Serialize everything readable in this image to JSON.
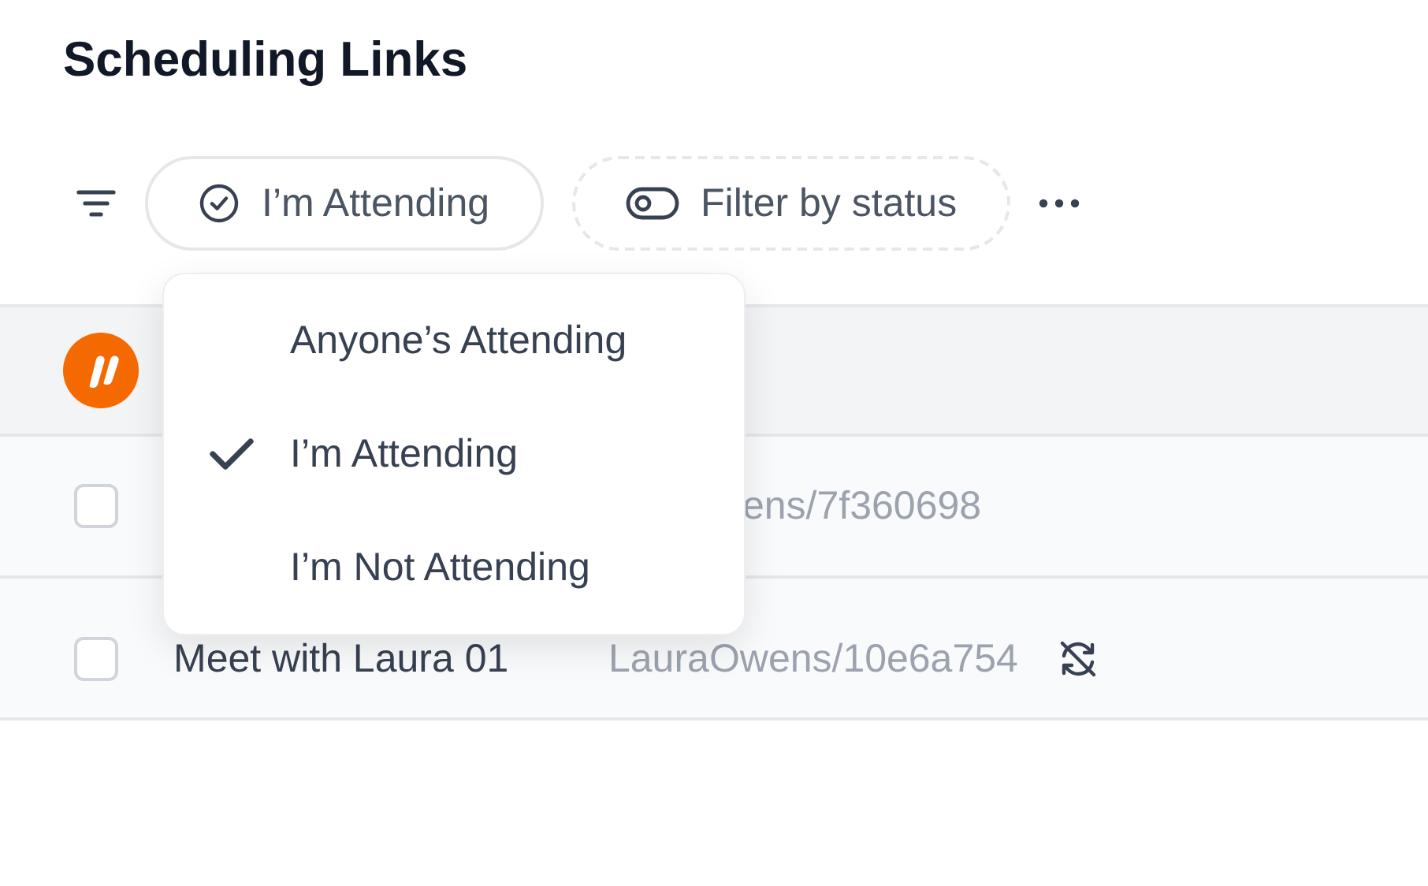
{
  "title": "Scheduling Links",
  "toolbar": {
    "filters": [
      {
        "kind": "attending",
        "label": "I’m Attending"
      },
      {
        "kind": "status",
        "label": "Filter by status"
      }
    ]
  },
  "menu": {
    "items": [
      {
        "label": "Anyone’s Attending",
        "selected": false
      },
      {
        "label": "I’m Attending",
        "selected": true
      },
      {
        "label": "I’m Not Attending",
        "selected": false
      }
    ]
  },
  "rows": [
    {
      "link": "ens/7f360698",
      "checked": false,
      "sync_off": false
    },
    {
      "name": "Meet with Laura 01",
      "link": "LauraOwens/10e6a754",
      "checked": false,
      "sync_off": true
    }
  ]
}
